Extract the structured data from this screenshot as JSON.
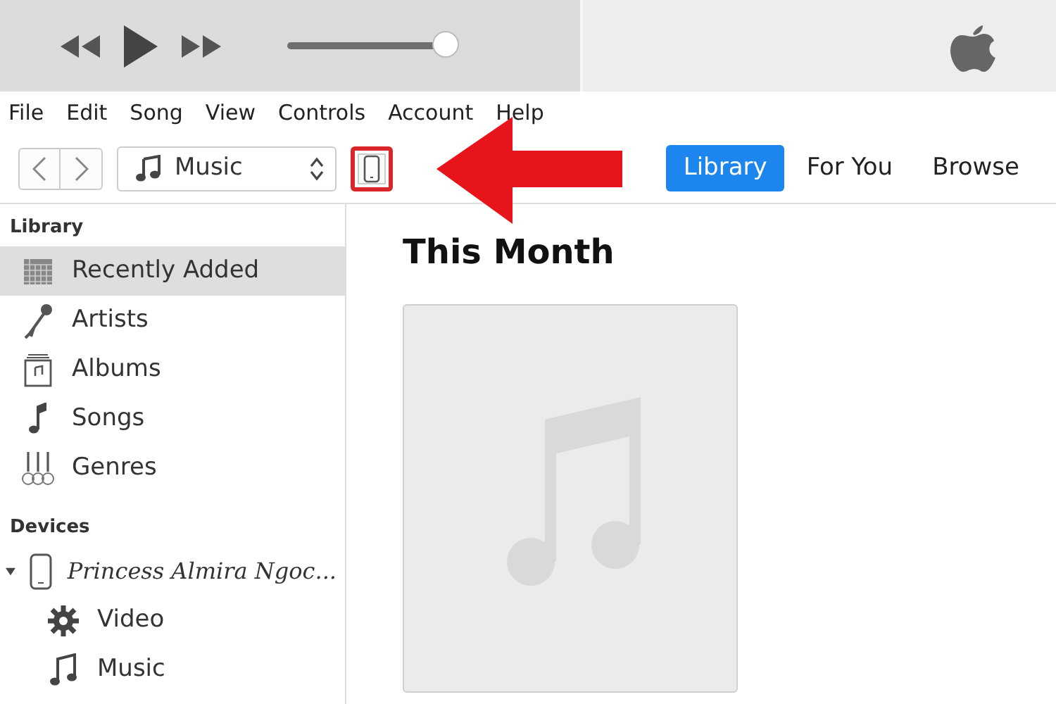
{
  "player": {
    "volume": {
      "level": 0.93
    }
  },
  "menu": [
    "File",
    "Edit",
    "Song",
    "View",
    "Controls",
    "Account",
    "Help"
  ],
  "toolbar": {
    "source": {
      "label": "Music"
    },
    "device_highlighted": true,
    "tabs": [
      {
        "label": "Library",
        "selected": true
      },
      {
        "label": "For You",
        "selected": false
      },
      {
        "label": "Browse",
        "selected": false
      }
    ]
  },
  "sidebar": {
    "sections": [
      {
        "heading": "Library",
        "items": [
          {
            "label": "Recently Added",
            "selected": true
          },
          {
            "label": "Artists",
            "selected": false
          },
          {
            "label": "Albums",
            "selected": false
          },
          {
            "label": "Songs",
            "selected": false
          },
          {
            "label": "Genres",
            "selected": false
          }
        ]
      },
      {
        "heading": "Devices",
        "items": [
          {
            "label": "Princess Almira Ngoc...",
            "kind": "device",
            "expanded": true,
            "selected": false,
            "children": [
              {
                "label": "Video",
                "selected": false
              },
              {
                "label": "Music",
                "selected": false
              }
            ]
          }
        ]
      }
    ]
  },
  "main": {
    "heading": "This Month"
  }
}
